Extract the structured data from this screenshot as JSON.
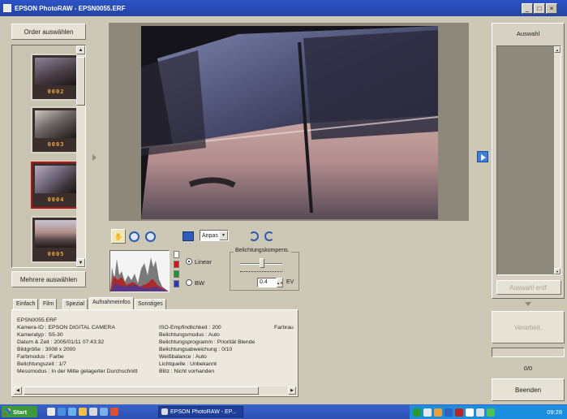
{
  "window": {
    "title": "EPSON PhotoRAW - EPSN0055.ERF",
    "min": "_",
    "max": "□",
    "close": "×"
  },
  "left": {
    "select_folder": "Order auswählen",
    "select_multiple": "Mehrere auswählen",
    "thumbnails": [
      "0002",
      "0003",
      "0004",
      "0005"
    ]
  },
  "toolbar": {
    "fit_value": "Anpas"
  },
  "histogram": {
    "linear": "Linear",
    "bw": "BW"
  },
  "exposure": {
    "title": "Belichtungskompens.",
    "value": "0.4",
    "unit": "EV"
  },
  "tabs": [
    "Einfach",
    "Film",
    "Spezial",
    "Aufnahmeinfos",
    "Sonstiges"
  ],
  "info": {
    "file": "EPSN0055.ERF",
    "left": [
      "Kamera-ID : EPSON DIGITAL CAMERA",
      "Kameratyp : S5-30",
      "Datum & Zeit : 2005/01/11 07:43:32",
      "Bildgröße : 3008 x 2000",
      "Farbmodus : Farbe",
      "Belichtungszeit : 1/7",
      "Messmodus : In der Mitte gelagerter Durchschnitt"
    ],
    "right": [
      "ISO-Empfindlichkeit : 200",
      "Belichtungsmodus : Auto",
      "Belichtungsprogramm : Priorität Blende",
      "Belichtungsabweichung : 0/10",
      "Weißbalance : Auto",
      "Lichtquelle : Unbekannt",
      "Blitz : Nicht vorhanden"
    ],
    "extra": "Farbrau"
  },
  "right": {
    "selection_title": "Auswahl",
    "remove_button": "Auswahl entf.",
    "process_button": "Verarbeit.",
    "count": "0/0",
    "quit_button": "Beenden"
  },
  "taskbar": {
    "start": "Start",
    "task": "EPSON PhotoRAW - EP...",
    "clock": "09:28"
  },
  "colors": {
    "titlebar": "#2344a6",
    "taskbar": "#2c4fb3",
    "thumb_number": "#f4a33c",
    "panel": "#cdc7b5"
  }
}
